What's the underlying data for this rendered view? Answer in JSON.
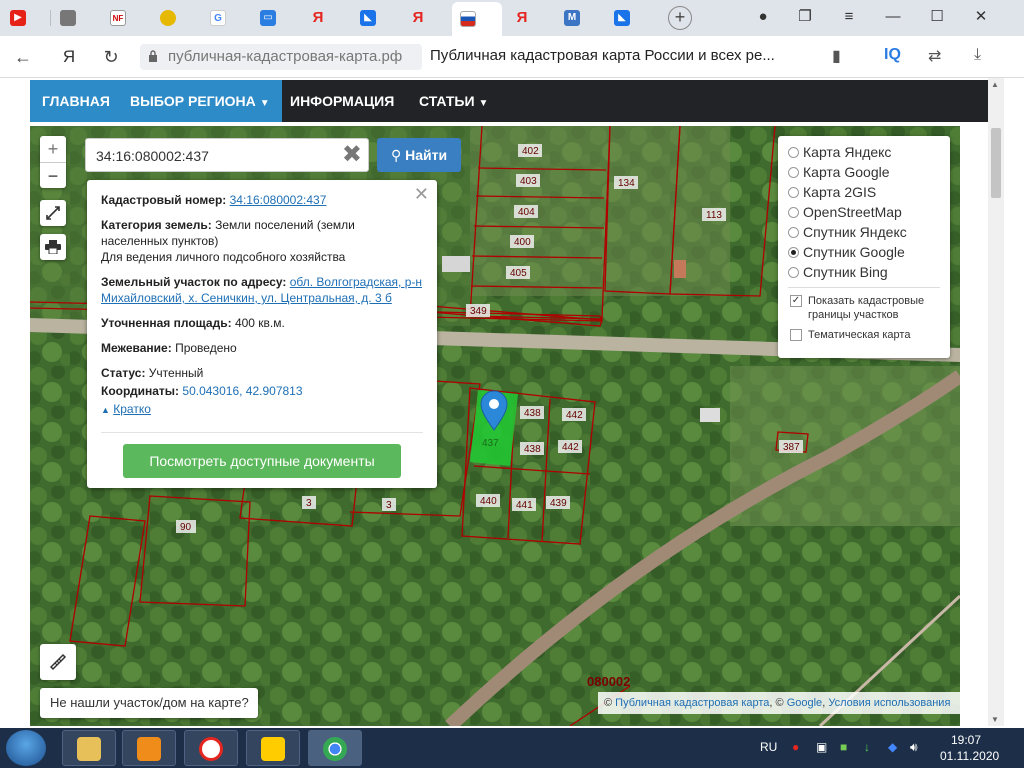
{
  "browser": {
    "url": "публичная-кадастровая-карта.рф",
    "page_title": "Публичная кадастровая карта России и всех ре...",
    "tab_badges": [
      "NF",
      "IQ"
    ]
  },
  "site_nav": {
    "items": [
      {
        "label": "ГЛАВНАЯ"
      },
      {
        "label": "ВЫБОР РЕГИОНА"
      },
      {
        "label": "ИНФОРМАЦИЯ"
      },
      {
        "label": "СТАТЬИ"
      }
    ]
  },
  "search": {
    "value": "34:16:080002:437",
    "button_label": "Найти"
  },
  "popup": {
    "cadastral_label": "Кадастровый номер:",
    "cadastral_value": "34:16:080002:437",
    "category_label": "Категория земель:",
    "category_value": "Земли поселений (земли населенных пунктов)",
    "use_value": "Для ведения личного подсобного хозяйства",
    "address_label": "Земельный участок по адресу:",
    "address_value": "обл. Волгоградская, р-н Михайловский, х. Сеничкин, ул. Центральная, д. 3 б",
    "area_label": "Уточненная площадь:",
    "area_value": "400 кв.м.",
    "survey_label": "Межевание:",
    "survey_value": "Проведено",
    "status_label": "Статус:",
    "status_value": "Учтенный",
    "coords_label": "Координаты:",
    "coords_value": "50.043016, 42.907813",
    "brief_label": "Кратко",
    "docs_button": "Посмотреть доступные документы"
  },
  "layers": {
    "options": [
      {
        "label": "Карта Яндекс",
        "selected": false
      },
      {
        "label": "Карта Google",
        "selected": false
      },
      {
        "label": "Карта 2GIS",
        "selected": false
      },
      {
        "label": "OpenStreetMap",
        "selected": false
      },
      {
        "label": "Спутник Яндекс",
        "selected": false
      },
      {
        "label": "Спутник Google",
        "selected": true
      },
      {
        "label": "Спутник Bing",
        "selected": false
      }
    ],
    "show_borders_label": "Показать кадастровые границы участков",
    "show_borders_checked": true,
    "thematic_label": "Тематическая карта",
    "thematic_checked": false
  },
  "map": {
    "zoom_in": "+",
    "zoom_out": "−",
    "parcel_labels": [
      "402",
      "403",
      "404",
      "400",
      "405",
      "134",
      "113",
      "349",
      "438",
      "442",
      "437",
      "438",
      "442",
      "387",
      "440",
      "441",
      "439",
      "3",
      "3",
      "90"
    ],
    "block_label": "080002",
    "not_found_label": "Не нашли участок/дом на карте?",
    "attribution_prefix": "©",
    "attribution_link1": "Публичная кадастровая карта",
    "attribution_mid": ", ©",
    "attribution_link2": "Google",
    "attribution_link3": "Условия использования"
  },
  "taskbar": {
    "language": "RU",
    "time": "19:07",
    "date": "01.11.2020"
  },
  "colors": {
    "nav_bg": "#222326",
    "nav_highlight": "#2d8bc8",
    "find_button": "#3a7fc1",
    "docs_button": "#5cb85c",
    "parcel_border": "#b00000",
    "selected_parcel": "#22c533",
    "marker": "#2b87d8"
  }
}
